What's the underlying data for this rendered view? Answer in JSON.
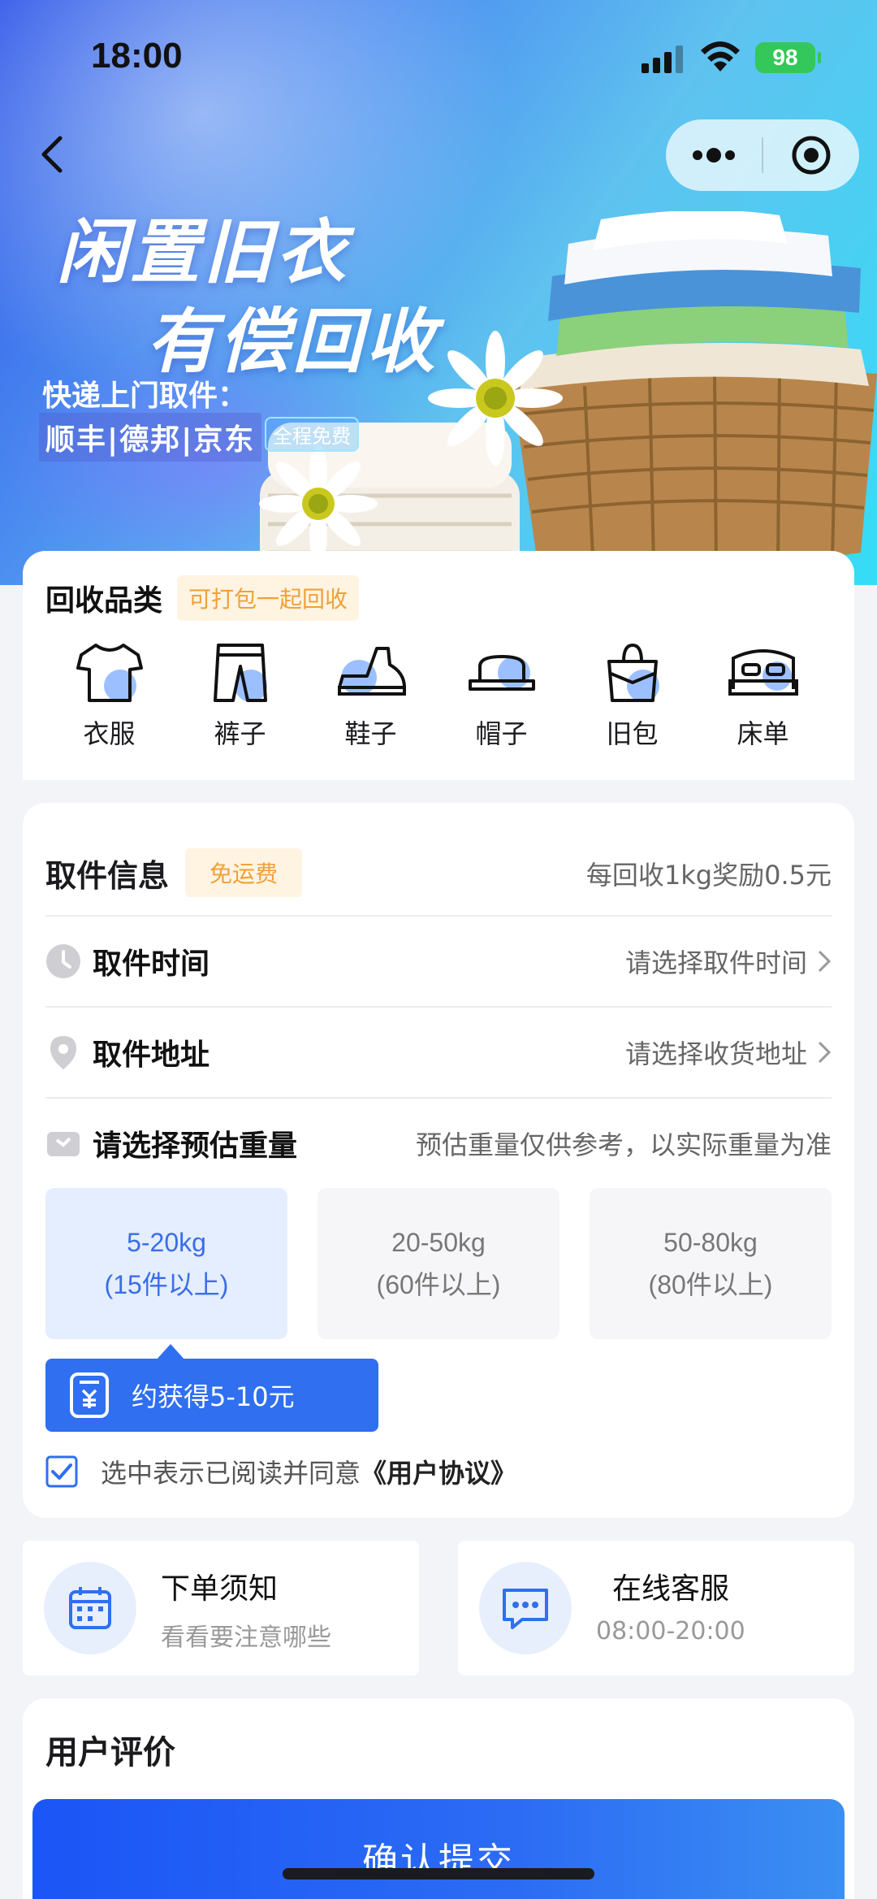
{
  "status_bar": {
    "time": "18:00",
    "battery": "98"
  },
  "banner": {
    "title_line1": "闲置旧衣",
    "title_line2": "有偿回收",
    "subtitle_line1": "快递上门取件：",
    "subtitle_line2": "顺丰|德邦|京东",
    "badge": "全程免费"
  },
  "category": {
    "title": "回收品类",
    "tag": "可打包一起回收",
    "items": [
      {
        "label": "衣服",
        "icon": "shirt-icon"
      },
      {
        "label": "裤子",
        "icon": "pants-icon"
      },
      {
        "label": "鞋子",
        "icon": "shoe-icon"
      },
      {
        "label": "帽子",
        "icon": "hat-icon"
      },
      {
        "label": "旧包",
        "icon": "bag-icon"
      },
      {
        "label": "床单",
        "icon": "bed-icon"
      }
    ]
  },
  "pickup": {
    "title": "取件信息",
    "tag": "免运费",
    "reward": "每回收1kg奖励0.5元",
    "time_label": "取件时间",
    "time_value": "请选择取件时间",
    "address_label": "取件地址",
    "address_value": "请选择收货地址",
    "weight_label": "请选择预估重量",
    "weight_note": "预估重量仅供参考，以实际重量为准",
    "weights": [
      {
        "range": "5-20kg",
        "count": "(15件以上)",
        "selected": true
      },
      {
        "range": "20-50kg",
        "count": "(60件以上)",
        "selected": false
      },
      {
        "range": "50-80kg",
        "count": "(80件以上)",
        "selected": false
      }
    ],
    "estimate": "约获得5-10元",
    "agree_text": "选中表示已阅读并同意",
    "agree_link": "《用户协议》",
    "agree_checked": true
  },
  "info_cards": {
    "notice_title": "下单须知",
    "notice_sub": "看看要注意哪些",
    "service_title": "在线客服",
    "service_sub": "08:00-20:00"
  },
  "reviews": {
    "title": "用户评价"
  },
  "submit_label": "确认提交",
  "colors": {
    "primary": "#2f6ff0",
    "tag_bg": "#fff4e2",
    "tag_text": "#f0a03a",
    "selected_bg": "#e5eefe"
  }
}
